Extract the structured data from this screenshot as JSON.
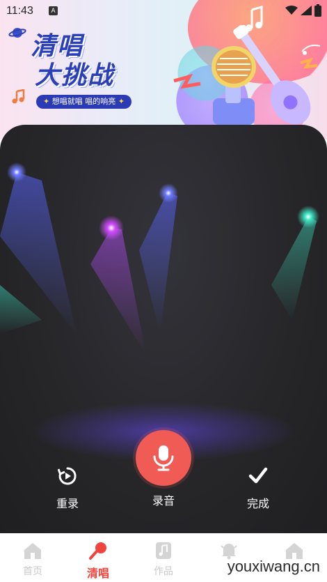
{
  "status_bar": {
    "time": "11:43",
    "app_badge": "A"
  },
  "banner": {
    "title_line1": "清唱",
    "title_line2": "大挑战",
    "slogan": "想唱就唱 唱的响亮",
    "colors": {
      "title": "#2a3fb8",
      "pill": "#2b3bb5",
      "star": "#ffd54a"
    }
  },
  "controls": {
    "retake_label": "重录",
    "record_label": "录音",
    "finish_label": "完成",
    "record_color": "#f15b55"
  },
  "tab_bar": {
    "tabs": [
      {
        "label": "首页",
        "icon": "home-icon",
        "active": false
      },
      {
        "label": "清唱",
        "icon": "microphone-icon",
        "active": true
      },
      {
        "label": "作品",
        "icon": "music-note-icon",
        "active": false
      },
      {
        "label": "",
        "icon": "bell-icon",
        "active": false
      },
      {
        "label": "",
        "icon": "home-icon",
        "active": false
      }
    ],
    "active_color": "#f0453f",
    "inactive_color": "#c9c9c9"
  },
  "watermark": "youxiwang.cn"
}
